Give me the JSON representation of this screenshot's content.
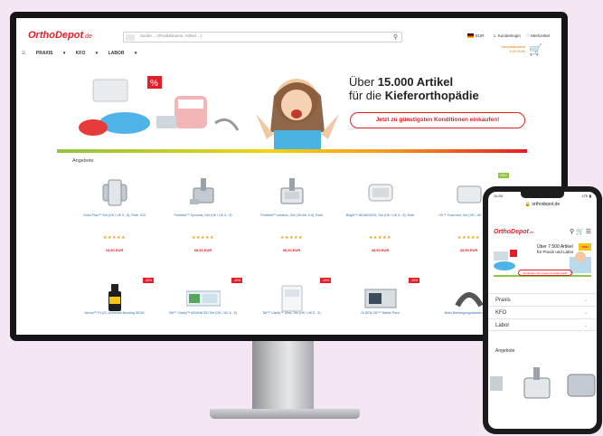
{
  "brand": {
    "name": "OrthoDepot",
    "domain": ".de",
    "accent": "#e41e26"
  },
  "desktop": {
    "search_placeholder": "Suche ... (Produktname, Artikel ...)",
    "header_links": [
      "EUR",
      "Kundenlogin",
      "Merkzettel"
    ],
    "cart_note": "Versandkosten 0,00 EUR",
    "nav": [
      "PRAXIS",
      "KFO",
      "LABOR"
    ],
    "banner": {
      "line1_prefix": "Über ",
      "line1_bold": "15.000 Artikel",
      "line2_prefix": "für die ",
      "line2_bold": "Kieferorthopädie",
      "button": "Jetzt zu günstigsten Konditionen einkaufen!"
    },
    "section_title": "Angebote",
    "products_row1": [
      {
        "name": "Omni Plus™ Set (OK / UK 5 - 5), Roth .022",
        "stars": "★★★★★",
        "price": "19,90 EUR"
      },
      {
        "name": "ProMeta™ Zyrconia, Set (OK / UK 5 - 5)",
        "stars": "★★★★★",
        "price": "99,90 EUR"
      },
      {
        "name": "ProMeta™ ceramic, Set (OK/UK 5-5), Roth",
        "stars": "★★★★★",
        "price": "99,90 EUR"
      },
      {
        "name": "Bright™ ADVANCED, Set (OK / UK 5 - 5), Roth",
        "stars": "★★★★★",
        "price": "49,90 EUR"
      },
      {
        "name": "OS™ Dual mini, Set (OK / UK 5 - 5), Roth",
        "stars": "★★★★★",
        "price": "33,90 EUR",
        "badge": "NEU"
      }
    ],
    "products_row2": [
      {
        "name": "Nexus™ PLUS, Universal Bonding SE2M",
        "badge": "-10%"
      },
      {
        "name": "3M™ Clarity™ ADVANCED Set (OK / UK 5 - 5)",
        "badge": "-10%"
      },
      {
        "name": "3M™ Clarity™ Ultra, Set (OK / UK 5 - 5)",
        "badge": "-10%"
      },
      {
        "name": "OLSEN OB™ Starter Pack",
        "badge": "-10%"
      },
      {
        "name": "Bebo Befestigungsbacken, Single",
        "badge": "-10%"
      }
    ]
  },
  "mobile": {
    "time": "11:28",
    "signal": "LTE",
    "url": "orthodepot.de",
    "banner_line1": "Über 7.500 Artikel",
    "banner_line2": "für Praxis und Labor",
    "banner_badge": "neu",
    "banner_button": "Entdecken Sie unsere Produktvielfalt",
    "menu": [
      "Praxis",
      "KFO",
      "Labor"
    ],
    "section_title": "Angebote"
  }
}
